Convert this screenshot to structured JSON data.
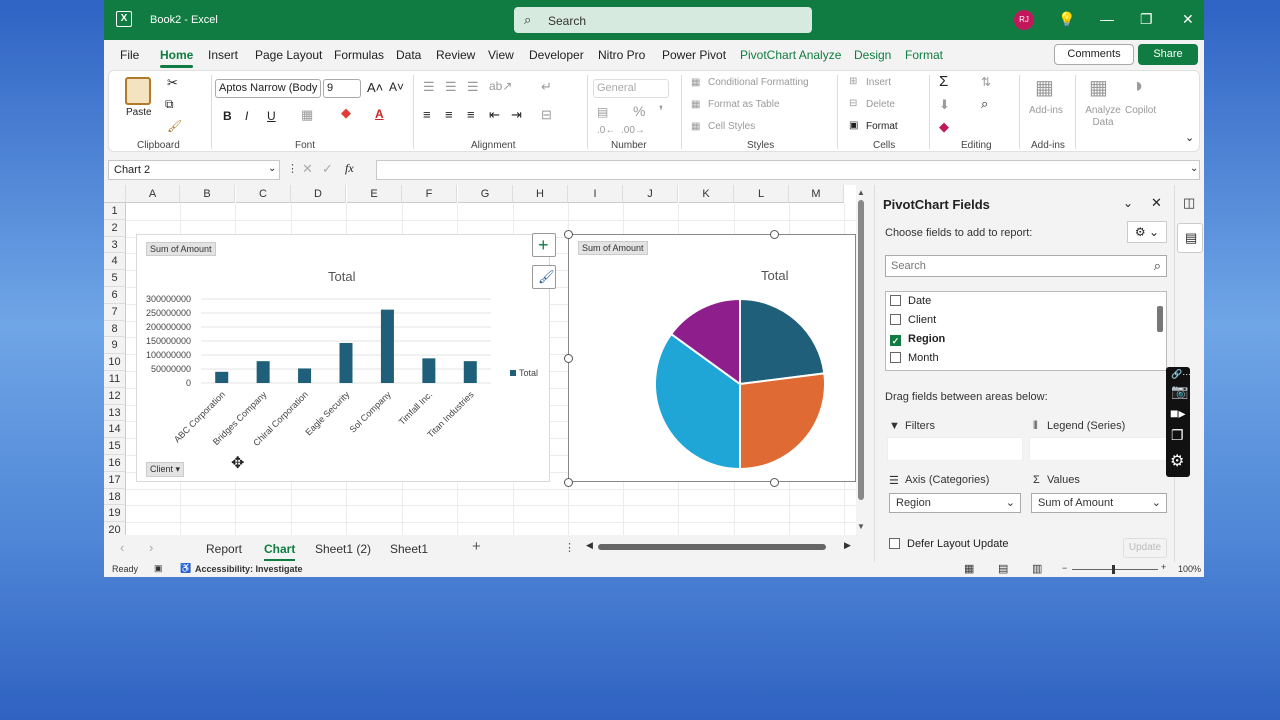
{
  "titlebar": {
    "logo": "X",
    "title": "Book2 - Excel",
    "search_placeholder": "Search",
    "user_initials": "RJ",
    "icons": [
      "lightbulb-icon",
      "minimize-icon",
      "restore-icon",
      "close-icon"
    ]
  },
  "menu": {
    "tabs": [
      "File",
      "Home",
      "Insert",
      "Page Layout",
      "Formulas",
      "Data",
      "Review",
      "View",
      "Developer",
      "Nitro Pro",
      "Power Pivot",
      "PivotChart Analyze",
      "Design",
      "Format"
    ],
    "active": "Home",
    "comments": "Comments",
    "share": "Share"
  },
  "ribbon": {
    "groups": [
      "Clipboard",
      "Font",
      "Alignment",
      "Number",
      "Styles",
      "Cells",
      "Editing",
      "Add-ins"
    ],
    "paste": "Paste",
    "font_name": "Aptos Narrow (Body",
    "font_size": "9",
    "number_format": "General",
    "conditional_formatting": "Conditional Formatting",
    "format_as_table": "Format as Table",
    "cell_styles": "Cell Styles",
    "insert": "Insert",
    "delete": "Delete",
    "format": "Format",
    "addins": "Add-ins",
    "analyze_data": "Analyze Data",
    "copilot": "Copilot"
  },
  "formula": {
    "namebox": "Chart 2",
    "fx": "fx"
  },
  "grid": {
    "columns": [
      "A",
      "B",
      "C",
      "D",
      "E",
      "F",
      "G",
      "H",
      "I",
      "J",
      "K",
      "L",
      "M"
    ],
    "rows": [
      "1",
      "2",
      "3",
      "4",
      "5",
      "6",
      "7",
      "8",
      "9",
      "10",
      "11",
      "12",
      "13",
      "14",
      "15",
      "16",
      "17",
      "18",
      "19",
      "20"
    ]
  },
  "chart_data": [
    {
      "type": "bar",
      "title": "Total",
      "field_button": "Sum of Amount",
      "axis_field_button": "Client",
      "legend": "Total",
      "legend_position": "right",
      "categories": [
        "ABC Corporation",
        "Bridges Company",
        "Chiral Corporation",
        "Eagle Security",
        "Sol Company",
        "Timfall Inc.",
        "Titan Industries"
      ],
      "values": [
        40000000,
        78000000,
        52000000,
        143000000,
        262000000,
        88000000,
        78000000
      ],
      "yticks": [
        "300000000",
        "250000000",
        "200000000",
        "150000000",
        "100000000",
        "50000000",
        "0"
      ],
      "ylim": [
        0,
        300000000
      ],
      "color": "#1f5f7a"
    },
    {
      "type": "pie",
      "title": "Total",
      "field_button": "Sum of Amount",
      "values": [
        23,
        27,
        35,
        15
      ],
      "colors": [
        "#1f5f7a",
        "#e06a33",
        "#1fa6d6",
        "#8e1e8c"
      ]
    }
  ],
  "sheets": {
    "tabs": [
      "Report",
      "Chart",
      "Sheet1 (2)",
      "Sheet1"
    ],
    "active": "Chart"
  },
  "status": {
    "ready": "Ready",
    "accessibility": "Accessibility: Investigate",
    "zoom": "100%"
  },
  "pivot": {
    "title": "PivotChart Fields",
    "subtitle": "Choose fields to add to report:",
    "search_placeholder": "Search",
    "fields": [
      {
        "label": "Date",
        "checked": false
      },
      {
        "label": "Client",
        "checked": false
      },
      {
        "label": "Region",
        "checked": true
      },
      {
        "label": "Month",
        "checked": false
      }
    ],
    "drag_hint": "Drag fields between areas below:",
    "filters": "Filters",
    "legend": "Legend (Series)",
    "axis": "Axis (Categories)",
    "values": "Values",
    "axis_value": "Region",
    "values_value": "Sum of Amount",
    "defer": "Defer Layout Update",
    "update": "Update"
  }
}
